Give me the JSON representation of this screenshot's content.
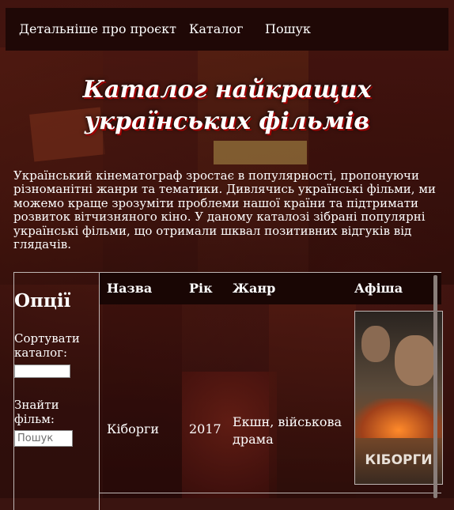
{
  "nav": {
    "items": [
      "Детальніше про проєкт",
      "Каталог",
      "Пошук"
    ]
  },
  "header": {
    "title": "Каталог найкращих українських фільмів"
  },
  "intro": {
    "text": "Український кінематограф зростає в популярності, пропонуючи різноманітні жанри та тематики. Дивлячись українські фільми, ми можемо краще зрозуміти проблеми нашої країни та підтримати розвиток вітчизняного кіно. У даному каталозі зібрані популярні українські фільми, що отримали шквал позитивних відгуків від глядачів."
  },
  "sidebar": {
    "title": "Опції",
    "sort_label": "Сортувати каталог:",
    "sort_value": "",
    "find_label": "Знайти фільм:",
    "find_placeholder": "Пошук"
  },
  "table": {
    "headers": [
      "Назва",
      "Рік",
      "Жанр",
      "Афіша"
    ],
    "rows": [
      {
        "name": "Кіборги",
        "year": "2017",
        "genre": "Екшн, військова драма",
        "poster_title": "КІБОРГИ"
      }
    ]
  },
  "colors": {
    "nav_bg": "#1f0806",
    "title_shadow": "#a00000",
    "header_bg": "#190604"
  }
}
